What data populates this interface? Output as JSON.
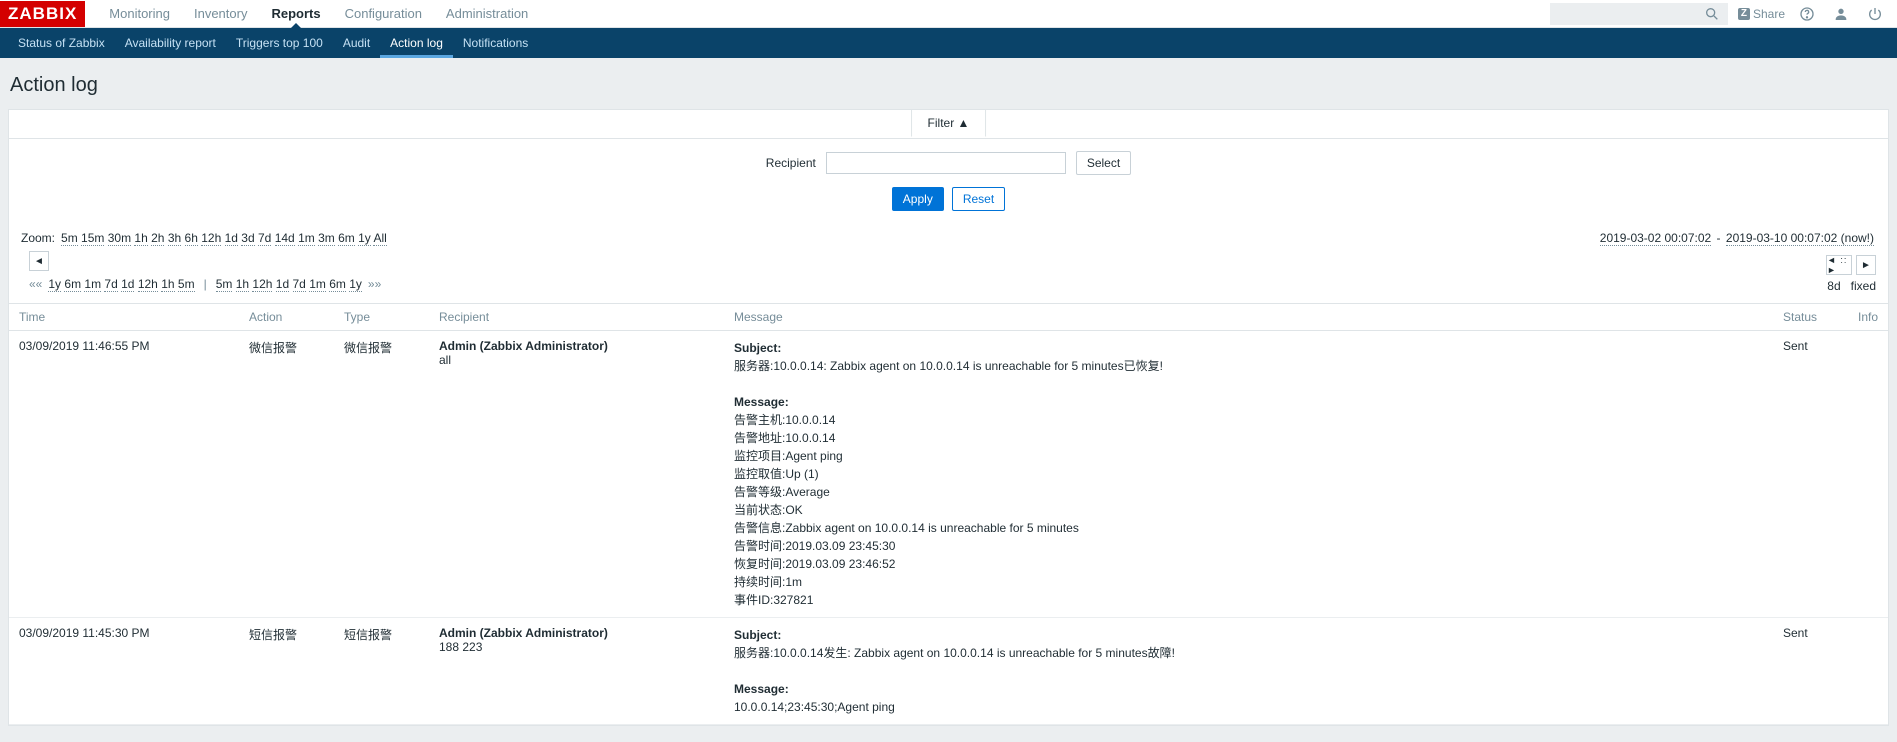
{
  "logo": "ZABBIX",
  "topnav": {
    "items": [
      {
        "label": "Monitoring"
      },
      {
        "label": "Inventory"
      },
      {
        "label": "Reports",
        "active": true
      },
      {
        "label": "Configuration"
      },
      {
        "label": "Administration"
      }
    ],
    "search_placeholder": "",
    "share_label": "Share"
  },
  "subnav": {
    "items": [
      {
        "label": "Status of Zabbix"
      },
      {
        "label": "Availability report"
      },
      {
        "label": "Triggers top 100"
      },
      {
        "label": "Audit"
      },
      {
        "label": "Action log",
        "active": true
      },
      {
        "label": "Notifications"
      }
    ]
  },
  "page_title": "Action log",
  "filter": {
    "tab_label": "Filter ▲",
    "recipient_label": "Recipient",
    "recipient_value": "",
    "select_btn": "Select",
    "apply_btn": "Apply",
    "reset_btn": "Reset"
  },
  "timenav": {
    "zoom_label": "Zoom:",
    "zoom_opts": [
      "5m",
      "15m",
      "30m",
      "1h",
      "2h",
      "3h",
      "6h",
      "12h",
      "1d",
      "3d",
      "7d",
      "14d",
      "1m",
      "3m",
      "6m",
      "1y",
      "All"
    ],
    "range_from": "2019-03-02 00:07:02",
    "range_to": "2019-03-10 00:07:02 (now!)",
    "shift_back_label": "««",
    "shift_back_opts": [
      "1y",
      "6m",
      "1m",
      "7d",
      "1d",
      "12h",
      "1h",
      "5m"
    ],
    "shift_fwd_opts": [
      "5m",
      "1h",
      "12h",
      "1d",
      "7d",
      "1m",
      "6m",
      "1y"
    ],
    "shift_fwd_label": "»»",
    "span_label": "8d",
    "fixed_label": "fixed"
  },
  "table": {
    "headers": [
      "Time",
      "Action",
      "Type",
      "Recipient",
      "Message",
      "Status",
      "Info"
    ],
    "rows": [
      {
        "time": "03/09/2019 11:46:55 PM",
        "action": "微信报警",
        "type": "微信报警",
        "recipient_name": "Admin (Zabbix Administrator)",
        "recipient_target": "all",
        "subject_label": "Subject:",
        "subject": "服务器:10.0.0.14: Zabbix agent on 10.0.0.14 is unreachable for 5 minutes已恢复!",
        "message_label": "Message:",
        "message_lines": [
          "告警主机:10.0.0.14",
          "告警地址:10.0.0.14",
          "监控项目:Agent ping",
          "监控取值:Up (1)",
          "告警等级:Average",
          "当前状态:OK",
          "告警信息:Zabbix agent on 10.0.0.14 is unreachable for 5 minutes",
          "告警时间:2019.03.09 23:45:30",
          "恢复时间:2019.03.09 23:46:52",
          "持续时间:1m",
          "事件ID:327821"
        ],
        "status": "Sent"
      },
      {
        "time": "03/09/2019 11:45:30 PM",
        "action": "短信报警",
        "type": "短信报警",
        "recipient_name": "Admin (Zabbix Administrator)",
        "recipient_target": "188        223",
        "subject_label": "Subject:",
        "subject": "服务器:10.0.0.14发生: Zabbix agent on 10.0.0.14 is unreachable for 5 minutes故障!",
        "message_label": "Message:",
        "message_lines": [
          "10.0.0.14;23:45:30;Agent ping"
        ],
        "status": "Sent"
      }
    ]
  }
}
